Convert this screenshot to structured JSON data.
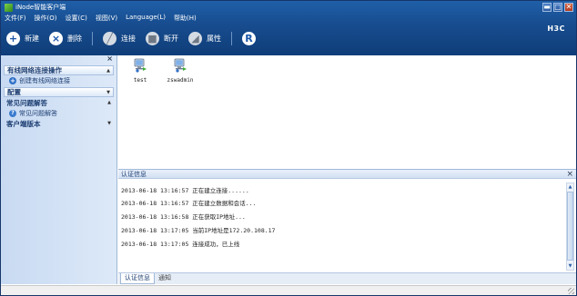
{
  "window": {
    "title": "iNode智能客户端",
    "controls": {
      "minimize": "▬",
      "maximize": "□",
      "close": "✕"
    }
  },
  "menu": [
    "文件(F)",
    "操作(O)",
    "设置(C)",
    "视图(V)",
    "Language(L)",
    "帮助(H)"
  ],
  "brand": "H3C",
  "toolbar": [
    {
      "label": "新建",
      "icon": "plus-icon",
      "glyph": "+",
      "style": "white"
    },
    {
      "label": "删除",
      "icon": "delete-icon",
      "glyph": "×",
      "style": "white"
    },
    {
      "label": "连接",
      "icon": "connect-icon",
      "glyph": "╱",
      "style": "grey"
    },
    {
      "label": "断开",
      "icon": "disconnect-icon",
      "glyph": "■",
      "style": "grey"
    },
    {
      "label": "属性",
      "icon": "properties-icon",
      "glyph": "◢",
      "style": "grey"
    },
    {
      "label": "",
      "icon": "r-icon",
      "glyph": "R",
      "style": "white"
    }
  ],
  "sidebar": {
    "close_glyph": "×",
    "sections": [
      {
        "title": "有线网络连接操作",
        "expanded": true,
        "items": [
          {
            "label": "创建有线网络连接",
            "icon": "plus-icon",
            "glyph": "+"
          }
        ]
      },
      {
        "title": "配置",
        "expanded": false,
        "items": []
      },
      {
        "title": "常见问题解答",
        "expanded": true,
        "items": [
          {
            "label": "常见问题解答",
            "icon": "question-icon",
            "glyph": "?"
          }
        ]
      },
      {
        "title": "客户端版本",
        "expanded": false,
        "items": []
      }
    ]
  },
  "connections": [
    {
      "label": "test",
      "icon": "network-pc-icon"
    },
    {
      "label": "zswadmin",
      "icon": "network-pc-icon"
    }
  ],
  "log": {
    "title": "认证信息",
    "close_glyph": "×",
    "lines": [
      "2013-06-18 13:16:57 正在建立连接......",
      "2013-06-18 13:16:57 正在建立数据和会话...",
      "2013-06-18 13:16:58 正在获取IP地址...",
      "2013-06-18 13:17:05 当前IP地址是172.20.108.17",
      "2013-06-18 13:17:05 连接成功，已上线"
    ],
    "scroll": {
      "up": "▲",
      "down": "▼"
    }
  },
  "tabs": [
    {
      "label": "认证信息",
      "active": true
    },
    {
      "label": "通知",
      "active": false
    }
  ],
  "colors": {
    "header": "#174c8e",
    "sidebar": "#d2e2f6",
    "accent": "#2e6fc7"
  }
}
